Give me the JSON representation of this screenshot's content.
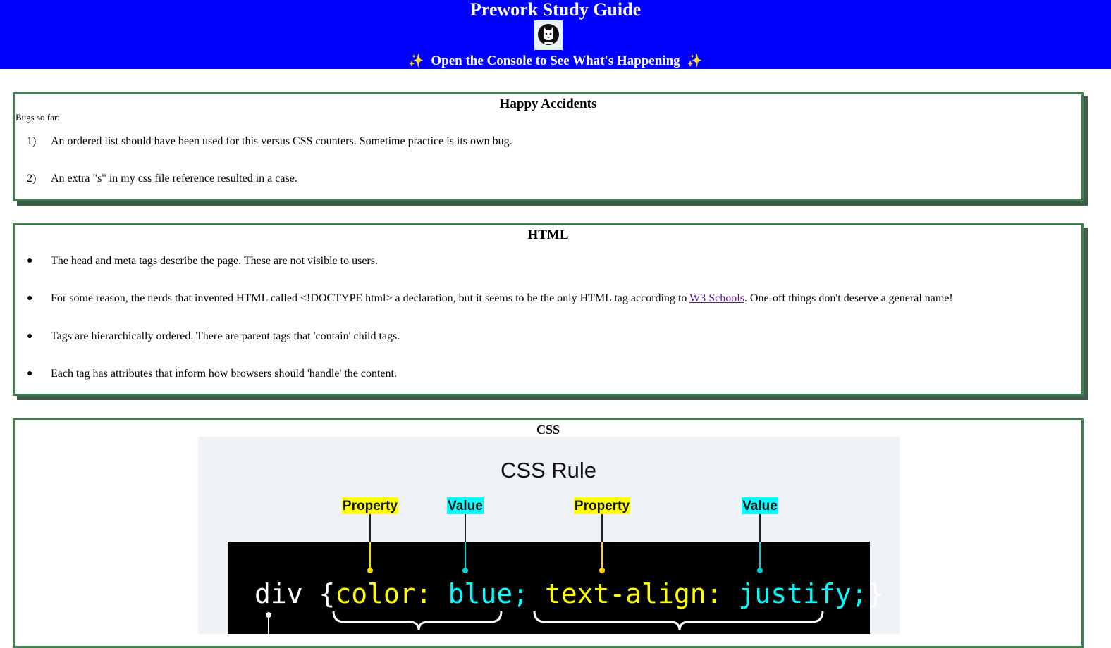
{
  "header": {
    "title": "Prework Study Guide",
    "sparkle_left": "✨",
    "subtitle": "Open the Console to See What's Happening",
    "sparkle_right": "✨",
    "logo_icon": "cat-icon",
    "background_color": "#0000ff"
  },
  "happy_accidents": {
    "title": "Happy Accidents",
    "label": "Bugs so far:",
    "items": [
      {
        "marker": "1)",
        "text": "An ordered list should have been used for this versus CSS counters. Sometime practice is its own bug."
      },
      {
        "marker": "2)",
        "text": "An extra \"s\" in my css file reference resulted in a case."
      }
    ]
  },
  "html_section": {
    "title": "HTML",
    "items": [
      {
        "text": "The head and meta tags describe the page. These are not visible to users."
      },
      {
        "text_before": "For some reason, the nerds that invented HTML called <!DOCTYPE html> a declaration, but it seems to be the only HTML tag according to ",
        "link": "W3 Schools",
        "text_after": ". One-off things don't deserve a general name!"
      },
      {
        "text": "Tags are hierarchically ordered. There are parent tags that 'contain' child tags."
      },
      {
        "text": "Each tag has attributes that inform how browsers should 'handle' the content."
      }
    ]
  },
  "css_section": {
    "title": "CSS",
    "diagram": {
      "heading": "CSS Rule",
      "labels": [
        "Property",
        "Value",
        "Property",
        "Value"
      ],
      "code": {
        "selector": "div",
        "open_brace": "{",
        "prop1": "color:",
        "val1": "blue;",
        "prop2": "text-align:",
        "val2": "justify;",
        "close_brace": "}"
      },
      "colors": {
        "property": "#ffff00",
        "value": "#00ffff",
        "code_bg": "#000000",
        "panel_bg": "#eff3f8"
      }
    }
  },
  "colors": {
    "card_border": "#3f7f4f",
    "card_shadow": "#3d5c47"
  }
}
